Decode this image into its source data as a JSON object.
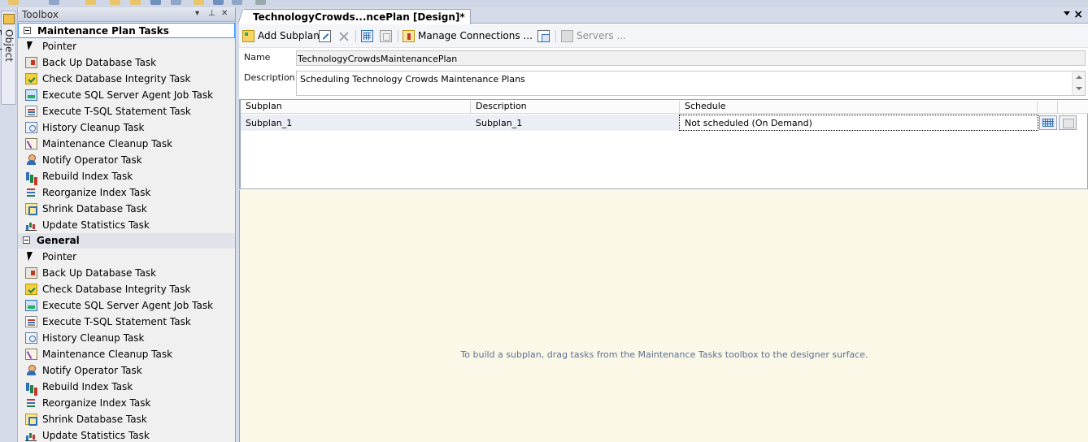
{
  "toolbox": {
    "title": "Toolbox",
    "categories": [
      {
        "name": "Maintenance Plan Tasks",
        "items": [
          {
            "label": "Pointer",
            "icon": "pointer-icon"
          },
          {
            "label": "Back Up Database Task",
            "icon": "backup-database-icon"
          },
          {
            "label": "Check Database Integrity Task",
            "icon": "check-integrity-icon"
          },
          {
            "label": "Execute SQL Server Agent Job Task",
            "icon": "agent-job-icon"
          },
          {
            "label": "Execute T-SQL Statement Task",
            "icon": "tsql-statement-icon"
          },
          {
            "label": "History Cleanup Task",
            "icon": "history-cleanup-icon"
          },
          {
            "label": "Maintenance Cleanup Task",
            "icon": "maintenance-cleanup-icon"
          },
          {
            "label": "Notify Operator Task",
            "icon": "notify-operator-icon"
          },
          {
            "label": "Rebuild Index Task",
            "icon": "rebuild-index-icon"
          },
          {
            "label": "Reorganize Index Task",
            "icon": "reorganize-index-icon"
          },
          {
            "label": "Shrink Database Task",
            "icon": "shrink-database-icon"
          },
          {
            "label": "Update Statistics Task",
            "icon": "update-statistics-icon"
          }
        ]
      },
      {
        "name": "General",
        "items": [
          {
            "label": "Pointer",
            "icon": "pointer-icon"
          },
          {
            "label": "Back Up Database Task",
            "icon": "backup-database-icon"
          },
          {
            "label": "Check Database Integrity Task",
            "icon": "check-integrity-icon"
          },
          {
            "label": "Execute SQL Server Agent Job Task",
            "icon": "agent-job-icon"
          },
          {
            "label": "Execute T-SQL Statement Task",
            "icon": "tsql-statement-icon"
          },
          {
            "label": "History Cleanup Task",
            "icon": "history-cleanup-icon"
          },
          {
            "label": "Maintenance Cleanup Task",
            "icon": "maintenance-cleanup-icon"
          },
          {
            "label": "Notify Operator Task",
            "icon": "notify-operator-icon"
          },
          {
            "label": "Rebuild Index Task",
            "icon": "rebuild-index-icon"
          },
          {
            "label": "Reorganize Index Task",
            "icon": "reorganize-index-icon"
          },
          {
            "label": "Shrink Database Task",
            "icon": "shrink-database-icon"
          },
          {
            "label": "Update Statistics Task",
            "icon": "update-statistics-icon"
          }
        ]
      }
    ]
  },
  "object_explorer": {
    "label": "Object Explorer"
  },
  "document": {
    "tab_title": "TechnologyCrowds...ncePlan [Design]*",
    "toolbar": {
      "add_subplan": "Add Subplan",
      "manage_connections": "Manage Connections ...",
      "servers": "Servers ..."
    },
    "name_label": "Name",
    "name_value": "TechnologyCrowdsMaintenancePlan",
    "description_label": "Description",
    "description_value": "Scheduling Technology Crowds Maintenance Plans",
    "grid": {
      "headers": [
        "Subplan",
        "Description",
        "Schedule"
      ],
      "rows": [
        {
          "subplan": "Subplan_1",
          "description": "Subplan_1",
          "schedule": "Not scheduled (On Demand)"
        }
      ]
    },
    "surface_hint": "To build a subplan, drag tasks from the Maintenance Tasks toolbox to the designer surface."
  },
  "colors": {
    "surface": "#fbf8e7",
    "selection_border": "#3399ff",
    "hint_text": "#5b6f93"
  }
}
